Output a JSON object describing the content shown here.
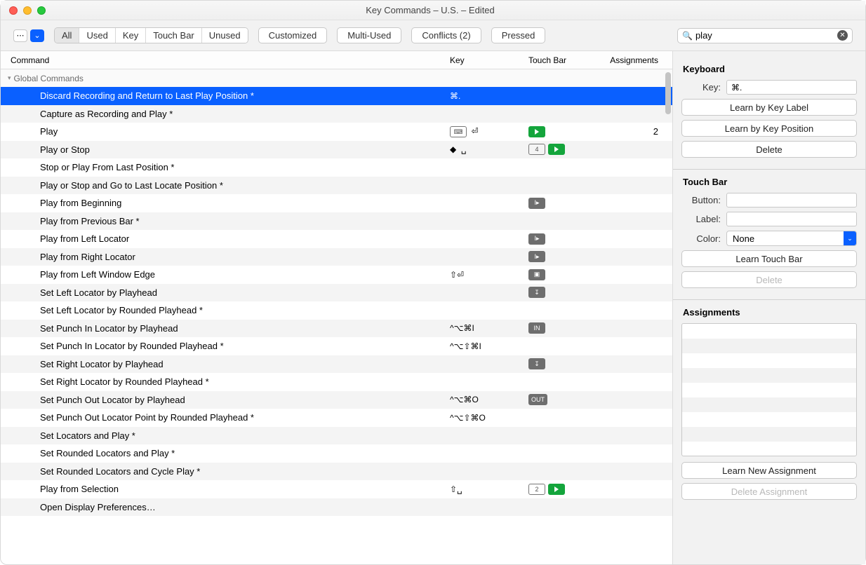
{
  "window_title": "Key Commands – U.S. – Edited",
  "filters": {
    "all": "All",
    "used": "Used",
    "key": "Key",
    "touch": "Touch Bar",
    "unused": "Unused"
  },
  "toolbar_buttons": {
    "customized": "Customized",
    "multi": "Multi-Used",
    "conflicts": "Conflicts (2)",
    "pressed": "Pressed"
  },
  "search_value": "play",
  "columns": {
    "command": "Command",
    "key": "Key",
    "touch": "Touch Bar",
    "assign": "Assignments"
  },
  "group_label": "Global Commands",
  "rows": [
    {
      "command": "Discard Recording and Return to Last Play Position *",
      "key": "⌘.",
      "touch_type": "none",
      "assign": "",
      "selected": true
    },
    {
      "command": "Capture as Recording and Play *",
      "key": "",
      "touch_type": "none",
      "assign": ""
    },
    {
      "command": "Play",
      "key": "⏎",
      "key_badge": true,
      "touch_type": "play_green",
      "assign": "2"
    },
    {
      "command": "Play or Stop",
      "key": "␣",
      "key_icon": true,
      "touch_type": "play_green_box",
      "assign": ""
    },
    {
      "command": "Stop or Play From Last Position *",
      "key": "",
      "touch_type": "none",
      "assign": ""
    },
    {
      "command": "Play or Stop and Go to Last Locate Position *",
      "key": "",
      "touch_type": "none",
      "assign": ""
    },
    {
      "command": "Play from Beginning",
      "key": "",
      "touch_type": "grey_play",
      "assign": ""
    },
    {
      "command": "Play from Previous Bar *",
      "key": "",
      "touch_type": "none",
      "assign": ""
    },
    {
      "command": "Play from Left Locator",
      "key": "",
      "touch_type": "grey_play",
      "assign": ""
    },
    {
      "command": "Play from Right Locator",
      "key": "",
      "touch_type": "grey_play",
      "assign": ""
    },
    {
      "command": "Play from Left Window Edge",
      "key": "⇧⏎",
      "touch_type": "grey_cam",
      "assign": ""
    },
    {
      "command": "Set Left Locator by Playhead",
      "key": "",
      "touch_type": "grey_mark",
      "assign": ""
    },
    {
      "command": "Set Left Locator by Rounded Playhead *",
      "key": "",
      "touch_type": "none",
      "assign": ""
    },
    {
      "command": "Set Punch In Locator by Playhead",
      "key": "^⌥⌘I",
      "touch_type": "grey_in",
      "assign": ""
    },
    {
      "command": "Set Punch In Locator by Rounded Playhead *",
      "key": "^⌥⇧⌘I",
      "touch_type": "none",
      "assign": ""
    },
    {
      "command": "Set Right Locator by Playhead",
      "key": "",
      "touch_type": "grey_mark",
      "assign": ""
    },
    {
      "command": "Set Right Locator by Rounded Playhead *",
      "key": "",
      "touch_type": "none",
      "assign": ""
    },
    {
      "command": "Set Punch Out Locator by Playhead",
      "key": "^⌥⌘O",
      "touch_type": "grey_out",
      "assign": ""
    },
    {
      "command": "Set Punch Out Locator Point by Rounded Playhead *",
      "key": "^⌥⇧⌘O",
      "touch_type": "none",
      "assign": ""
    },
    {
      "command": "Set Locators and Play *",
      "key": "",
      "touch_type": "none",
      "assign": ""
    },
    {
      "command": "Set Rounded Locators and Play *",
      "key": "",
      "touch_type": "none",
      "assign": ""
    },
    {
      "command": "Set Rounded Locators and Cycle Play *",
      "key": "",
      "touch_type": "none",
      "assign": ""
    },
    {
      "command": "Play from Selection",
      "key": "⇧␣",
      "touch_type": "play_green_box2",
      "assign": ""
    },
    {
      "command": "Open Display Preferences…",
      "key": "",
      "touch_type": "none",
      "assign": ""
    }
  ],
  "panel": {
    "keyboard_title": "Keyboard",
    "key_label": "Key:",
    "key_value": "⌘.",
    "learn_key_label": "Learn by Key Label",
    "learn_key_pos": "Learn by Key Position",
    "delete": "Delete",
    "touch_title": "Touch Bar",
    "button_label": "Button:",
    "button_value": "",
    "label_label": "Label:",
    "label_value": "",
    "color_label": "Color:",
    "color_value": "None",
    "learn_touch": "Learn Touch Bar",
    "delete2": "Delete",
    "assign_title": "Assignments",
    "learn_new": "Learn New Assignment",
    "delete_assign": "Delete Assignment"
  }
}
